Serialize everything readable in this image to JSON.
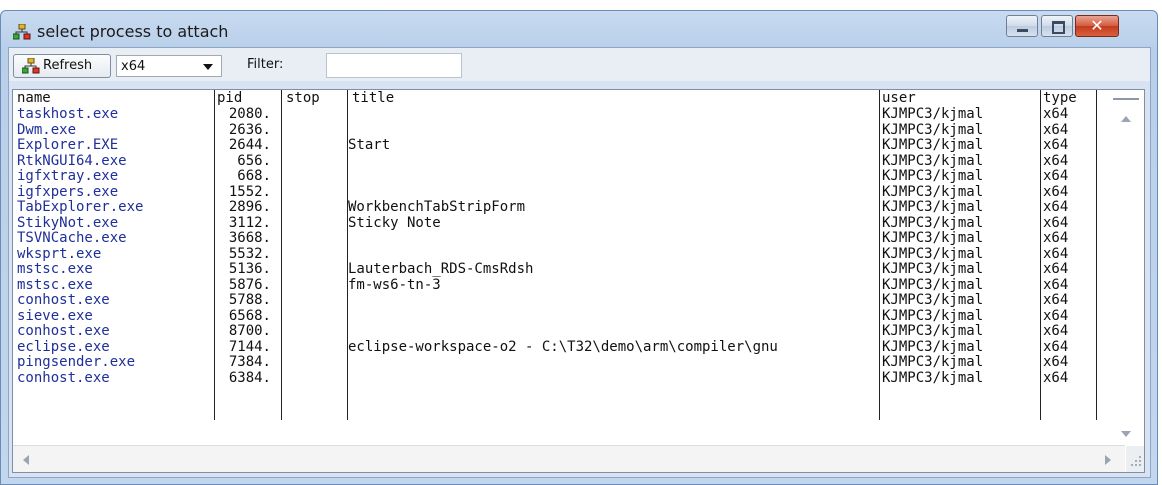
{
  "window": {
    "title": "select process to attach",
    "icon": "process-tree-icon",
    "close_glyph": "✕"
  },
  "toolbar": {
    "refresh_label": "Refresh",
    "arch_selected": "x64",
    "filter_label": "Filter:",
    "filter_value": ""
  },
  "columns": {
    "name": "name",
    "pid": "pid",
    "stop": "stop",
    "title": "title",
    "user": "user",
    "type": "type"
  },
  "rows": [
    {
      "name": "taskhost.exe",
      "pid": "2080.",
      "stop": "",
      "title": "",
      "user": "KJMPC3/kjmal",
      "type": "x64"
    },
    {
      "name": "Dwm.exe",
      "pid": "2636.",
      "stop": "",
      "title": "",
      "user": "KJMPC3/kjmal",
      "type": "x64"
    },
    {
      "name": "Explorer.EXE",
      "pid": "2644.",
      "stop": "",
      "title": "Start",
      "user": "KJMPC3/kjmal",
      "type": "x64"
    },
    {
      "name": "RtkNGUI64.exe",
      "pid": "656.",
      "stop": "",
      "title": "",
      "user": "KJMPC3/kjmal",
      "type": "x64"
    },
    {
      "name": "igfxtray.exe",
      "pid": "668.",
      "stop": "",
      "title": "",
      "user": "KJMPC3/kjmal",
      "type": "x64"
    },
    {
      "name": "igfxpers.exe",
      "pid": "1552.",
      "stop": "",
      "title": "",
      "user": "KJMPC3/kjmal",
      "type": "x64"
    },
    {
      "name": "TabExplorer.exe",
      "pid": "2896.",
      "stop": "",
      "title": "WorkbenchTabStripForm",
      "user": "KJMPC3/kjmal",
      "type": "x64"
    },
    {
      "name": "StikyNot.exe",
      "pid": "3112.",
      "stop": "",
      "title": "Sticky Note",
      "user": "KJMPC3/kjmal",
      "type": "x64"
    },
    {
      "name": "TSVNCache.exe",
      "pid": "3668.",
      "stop": "",
      "title": "",
      "user": "KJMPC3/kjmal",
      "type": "x64"
    },
    {
      "name": "wksprt.exe",
      "pid": "5532.",
      "stop": "",
      "title": "",
      "user": "KJMPC3/kjmal",
      "type": "x64"
    },
    {
      "name": "mstsc.exe",
      "pid": "5136.",
      "stop": "",
      "title": "Lauterbach_RDS-CmsRdsh",
      "user": "KJMPC3/kjmal",
      "type": "x64"
    },
    {
      "name": "mstsc.exe",
      "pid": "5876.",
      "stop": "",
      "title": "fm-ws6-tn-3",
      "user": "KJMPC3/kjmal",
      "type": "x64"
    },
    {
      "name": "conhost.exe",
      "pid": "5788.",
      "stop": "",
      "title": "",
      "user": "KJMPC3/kjmal",
      "type": "x64"
    },
    {
      "name": "sieve.exe",
      "pid": "6568.",
      "stop": "",
      "title": "",
      "user": "KJMPC3/kjmal",
      "type": "x64"
    },
    {
      "name": "conhost.exe",
      "pid": "8700.",
      "stop": "",
      "title": "",
      "user": "KJMPC3/kjmal",
      "type": "x64"
    },
    {
      "name": "eclipse.exe",
      "pid": "7144.",
      "stop": "",
      "title": "eclipse-workspace-o2 - C:\\T32\\demo\\arm\\compiler\\gnu",
      "user": "KJMPC3/kjmal",
      "type": "x64"
    },
    {
      "name": "pingsender.exe",
      "pid": "7384.",
      "stop": "",
      "title": "",
      "user": "KJMPC3/kjmal",
      "type": "x64"
    },
    {
      "name": "conhost.exe",
      "pid": "6384.",
      "stop": "",
      "title": "",
      "user": "KJMPC3/kjmal",
      "type": "x64"
    }
  ]
}
